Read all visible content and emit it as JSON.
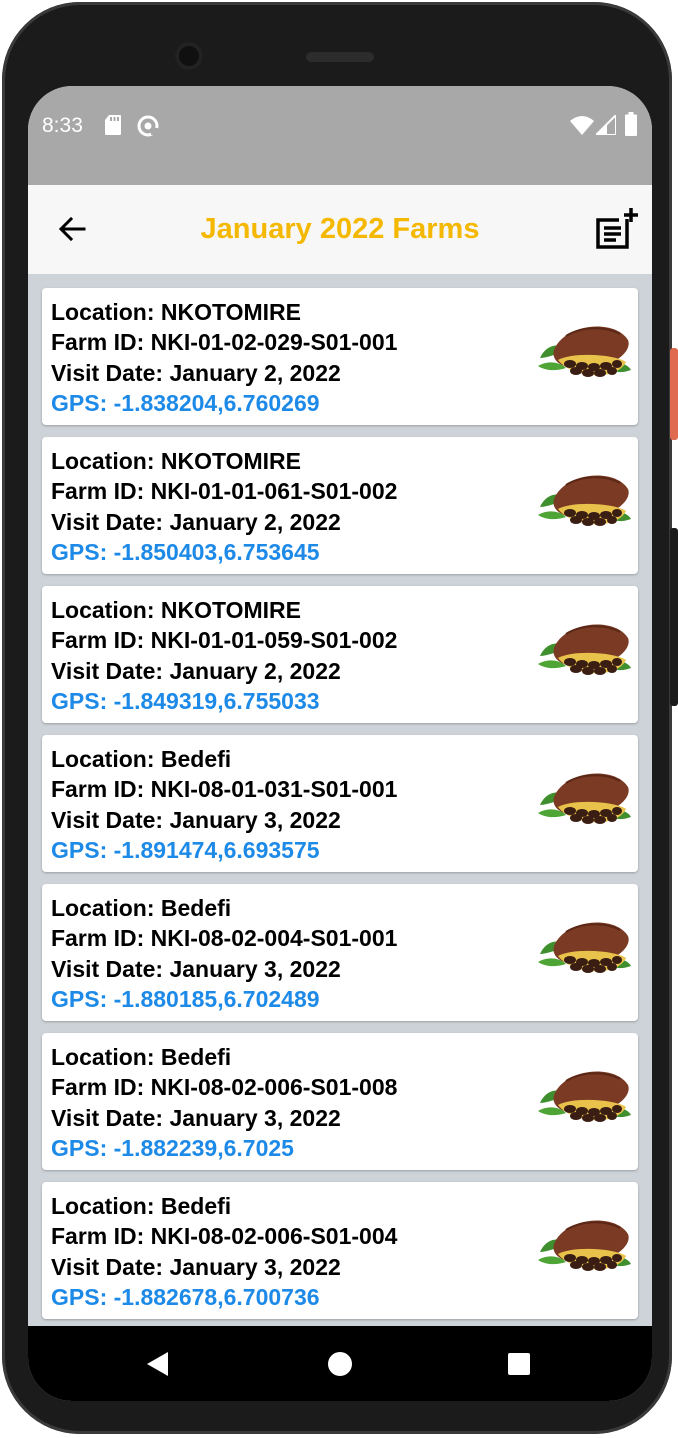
{
  "status_bar": {
    "time": "8:33"
  },
  "app_bar": {
    "title": "January 2022 Farms"
  },
  "farms": [
    {
      "location": "Location: NKOTOMIRE",
      "farm_id": "Farm ID: NKI-01-02-029-S01-001",
      "visit_date": "Visit Date: January 2, 2022",
      "gps": "GPS: -1.838204,6.760269"
    },
    {
      "location": "Location: NKOTOMIRE",
      "farm_id": "Farm ID: NKI-01-01-061-S01-002",
      "visit_date": "Visit Date: January 2, 2022",
      "gps": "GPS: -1.850403,6.753645"
    },
    {
      "location": "Location: NKOTOMIRE",
      "farm_id": "Farm ID: NKI-01-01-059-S01-002",
      "visit_date": "Visit Date: January 2, 2022",
      "gps": "GPS: -1.849319,6.755033"
    },
    {
      "location": "Location: Bedefi",
      "farm_id": "Farm ID: NKI-08-01-031-S01-001",
      "visit_date": "Visit Date: January 3, 2022",
      "gps": "GPS: -1.891474,6.693575"
    },
    {
      "location": "Location: Bedefi",
      "farm_id": "Farm ID: NKI-08-02-004-S01-001",
      "visit_date": "Visit Date: January 3, 2022",
      "gps": "GPS: -1.880185,6.702489"
    },
    {
      "location": "Location: Bedefi",
      "farm_id": "Farm ID: NKI-08-02-006-S01-008",
      "visit_date": "Visit Date: January 3, 2022",
      "gps": "GPS: -1.882239,6.7025"
    },
    {
      "location": "Location: Bedefi",
      "farm_id": "Farm ID: NKI-08-02-006-S01-004",
      "visit_date": "Visit Date: January 3, 2022",
      "gps": "GPS: -1.882678,6.700736"
    }
  ],
  "icons": {
    "back": "arrow-back-icon",
    "action": "note-add-icon",
    "farm": "cocoa-pod-icon",
    "nav": [
      "back-triangle-icon",
      "home-circle-icon",
      "recents-square-icon"
    ]
  },
  "colors": {
    "title": "#f5b800",
    "gps": "#1e8ae8",
    "status_bar": "#a8a8a8",
    "app_bar": "#f7f7f7",
    "list_background": "#cdd3d8"
  }
}
